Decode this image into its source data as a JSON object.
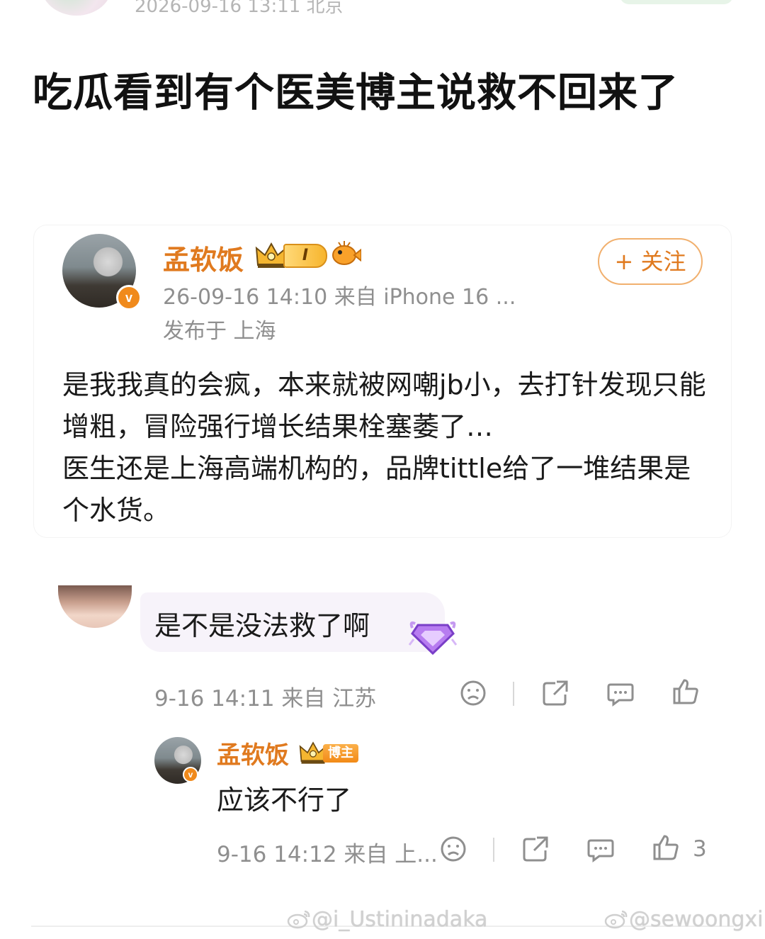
{
  "header": {
    "time_location": "2026-09-16 13:11  北京"
  },
  "post": {
    "title": "吃瓜看到有个医美博主说救不回来了"
  },
  "card": {
    "name": "孟软饭",
    "level": "I",
    "meta": "26-09-16 14:10  来自 iPhone 16 ...",
    "location": "发布于 上海",
    "follow_label": "+ 关注",
    "verified_mark": "v",
    "body": "是我我真的会疯，本来就被网嘲jb小，去打针发现只能增粗，冒险强行增长结果栓塞萎了…\n医生还是上海高端机构的，品牌tittle给了一堆结果是个水货。"
  },
  "comment": {
    "text": "是不是没法救了啊",
    "meta": "9-16 14:11  来自 江苏"
  },
  "reply": {
    "name": "孟软饭",
    "tag": "博主",
    "verified_mark": "v",
    "text": "应该不行了",
    "meta": "9-16 14:12  来自 上...",
    "like_count": "3"
  },
  "watermarks": {
    "left": "@i_Ustininadaka",
    "right": "@sewoongxi"
  },
  "colors": {
    "name": "#e07a1f",
    "meta": "#8f8f8f",
    "verified": "#f08a1c"
  }
}
